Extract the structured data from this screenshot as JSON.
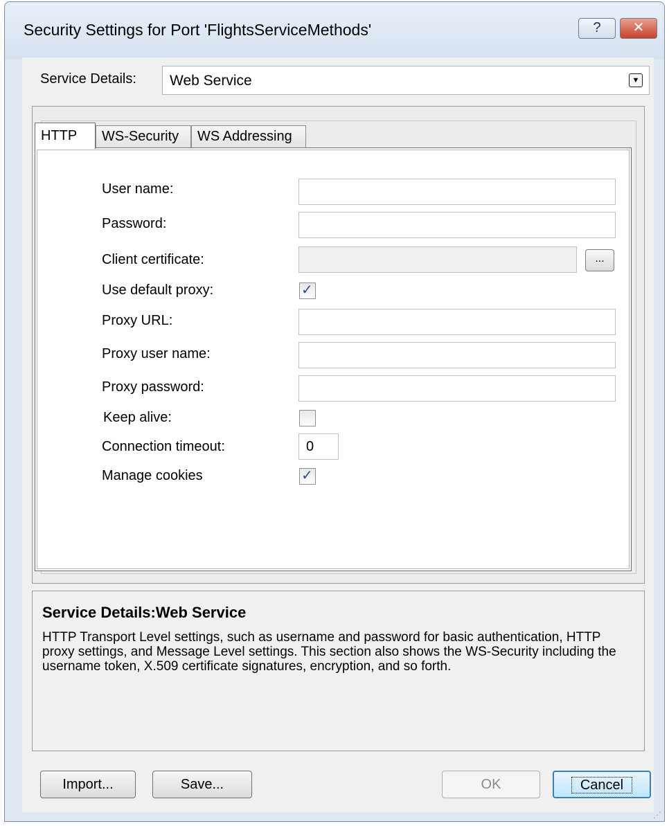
{
  "window": {
    "title": "Security Settings for Port 'FlightsServiceMethods'",
    "help_label": "?",
    "close_label": "✕"
  },
  "service": {
    "label": "Service Details:",
    "value": "Web Service"
  },
  "tabs": [
    {
      "label": "HTTP",
      "active": true
    },
    {
      "label": "WS-Security",
      "active": false
    },
    {
      "label": "WS Addressing",
      "active": false
    }
  ],
  "http": {
    "user_name_label": "User name:",
    "user_name_value": "",
    "password_label": "Password:",
    "password_value": "",
    "client_certificate_label": "Client certificate:",
    "client_certificate_value": "",
    "browse_label": "...",
    "use_default_proxy_label": "Use default proxy:",
    "use_default_proxy": true,
    "proxy_url_label": "Proxy URL:",
    "proxy_url_value": "",
    "proxy_user_name_label": "Proxy user name:",
    "proxy_user_name_value": "",
    "proxy_password_label": "Proxy password:",
    "proxy_password_value": "",
    "keep_alive_label": "Keep alive:",
    "keep_alive": false,
    "connection_timeout_label": "Connection timeout:",
    "connection_timeout_value": "0",
    "manage_cookies_label": "Manage cookies",
    "manage_cookies": true
  },
  "description": {
    "title": "Service Details:Web Service",
    "text": "HTTP Transport Level settings, such as username and password for basic authentication, HTTP proxy settings, and Message Level settings. This section also shows the WS-Security including the username token, X.509 certificate signatures, encryption, and so forth."
  },
  "buttons": {
    "import": "Import...",
    "save": "Save...",
    "ok": "OK",
    "cancel": "Cancel"
  }
}
